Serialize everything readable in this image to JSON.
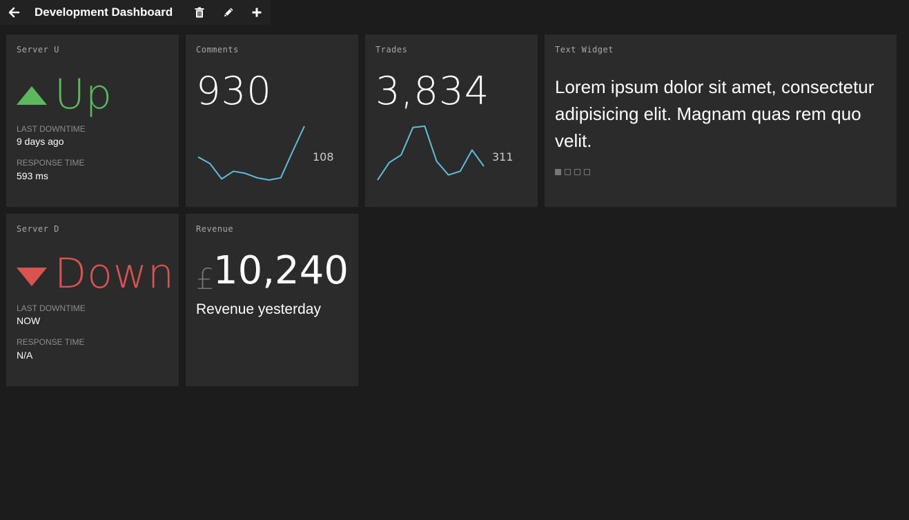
{
  "header": {
    "title": "Development Dashboard",
    "back_icon": "arrow-left-icon",
    "tools": [
      "trash-icon",
      "pencil-icon",
      "plus-icon"
    ]
  },
  "colors": {
    "background": "#1c1c1c",
    "widget": "#2b2b2b",
    "up": "#5cb85c",
    "down": "#d9534f",
    "sparkline": "#5bc0de"
  },
  "widgets": {
    "server_up": {
      "title": "Server U",
      "status": "Up",
      "last_downtime_label": "LAST DOWNTIME",
      "last_downtime": "9 days ago",
      "response_time_label": "RESPONSE TIME",
      "response_time": "593 ms"
    },
    "comments": {
      "title": "Comments",
      "value": "930",
      "last_point": "108",
      "sparkline": [
        20,
        14,
        0,
        7,
        5,
        1,
        -1,
        1,
        25,
        48
      ]
    },
    "trades": {
      "title": "Trades",
      "value": "3,834",
      "last_point": "311",
      "sparkline": [
        0,
        14,
        20,
        42,
        43,
        15,
        4,
        7,
        24,
        11
      ]
    },
    "text_widget": {
      "title": "Text Widget",
      "text": "Lorem ipsum dolor sit amet, consectetur adipisicing elit. Magnam quas rem quo velit.",
      "pages": 4,
      "active_page": 1
    },
    "server_down": {
      "title": "Server D",
      "status": "Down",
      "last_downtime_label": "LAST DOWNTIME",
      "last_downtime": "NOW",
      "response_time_label": "RESPONSE TIME",
      "response_time": "N/A"
    },
    "revenue": {
      "title": "Revenue",
      "currency": "£",
      "value": "10,240",
      "subtitle": "Revenue yesterday"
    }
  }
}
